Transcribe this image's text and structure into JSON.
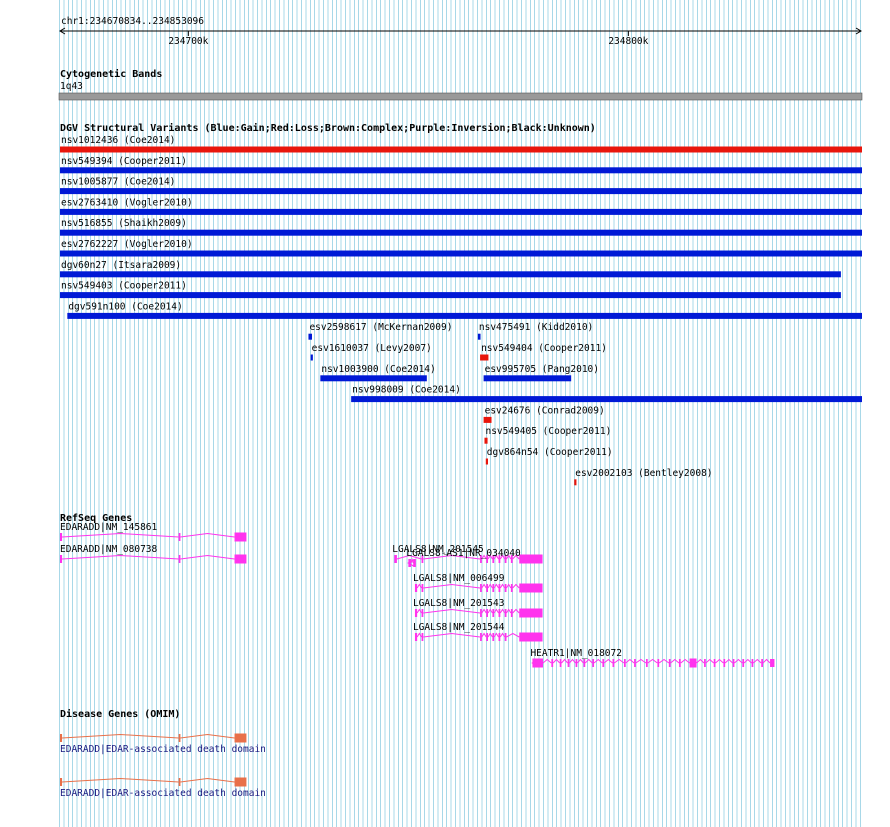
{
  "ruler": {
    "position_label": "chr1:234670834..234853096",
    "ticks": [
      {
        "pos": 234700000,
        "label": "234700k"
      },
      {
        "pos": 234800000,
        "label": "234800k"
      }
    ],
    "start": 234670834,
    "end": 234853096
  },
  "tracks": {
    "cytoband": {
      "title": "Cytogenetic Bands",
      "band_label": "1q43",
      "color": "#999999"
    },
    "dgv": {
      "title": "DGV Structural Variants (Blue:Gain;Red:Loss;Brown:Complex;Purple:Inversion;Black:Unknown)",
      "colors": {
        "gain": "#0019d6",
        "loss": "#e8160c"
      },
      "features": [
        {
          "label": "nsv1012436 (Coe2014)",
          "type": "loss",
          "start": 234670834,
          "end": 234853096
        },
        {
          "label": "nsv549394 (Cooper2011)",
          "type": "gain",
          "start": 234670834,
          "end": 234853096
        },
        {
          "label": "nsv1005877 (Coe2014)",
          "type": "gain",
          "start": 234670834,
          "end": 234853096
        },
        {
          "label": "esv2763410 (Vogler2010)",
          "type": "gain",
          "start": 234670834,
          "end": 234853096
        },
        {
          "label": "nsv516855 (Shaikh2009)",
          "type": "gain",
          "start": 234670834,
          "end": 234853096
        },
        {
          "label": "esv2762227 (Vogler2010)",
          "type": "gain",
          "start": 234670834,
          "end": 234853096
        },
        {
          "label": "dgv60n27 (Itsara2009)",
          "type": "gain",
          "start": 234670834,
          "end": 234848300
        },
        {
          "label": "nsv549403 (Cooper2011)",
          "type": "gain",
          "start": 234670834,
          "end": 234848300
        },
        {
          "label": "dgv591n100 (Coe2014)",
          "type": "gain",
          "start": 234672500,
          "end": 234853096
        },
        {
          "label": "esv2598617 (McKernan2009)",
          "type": "gain",
          "start": 234727300,
          "end": 234728100
        },
        {
          "label": "nsv475491 (Kidd2010)",
          "type": "gain",
          "start": 234765800,
          "end": 234766400
        },
        {
          "label": "esv1610037 (Levy2007)",
          "type": "gain",
          "start": 234727800,
          "end": 234728300
        },
        {
          "label": "nsv549404 (Cooper2011)",
          "type": "loss",
          "start": 234766300,
          "end": 234768200
        },
        {
          "label": "nsv1003900 (Coe2014)",
          "type": "gain",
          "start": 234730000,
          "end": 234754200
        },
        {
          "label": "esv995705 (Pang2010)",
          "type": "gain",
          "start": 234767100,
          "end": 234787000
        },
        {
          "label": "nsv998009 (Coe2014)",
          "type": "gain",
          "start": 234737000,
          "end": 234853096
        },
        {
          "label": "esv24676 (Conrad2009)",
          "type": "loss",
          "start": 234767100,
          "end": 234768900
        },
        {
          "label": "nsv549405 (Cooper2011)",
          "type": "loss",
          "start": 234767300,
          "end": 234768000
        },
        {
          "label": "dgv864n54 (Cooper2011)",
          "type": "loss",
          "start": 234767600,
          "end": 234768100
        },
        {
          "label": "esv2002103 (Bentley2008)",
          "type": "loss",
          "start": 234787700,
          "end": 234788200
        }
      ]
    },
    "refseq": {
      "title": "RefSeq Genes",
      "color": "#ff33ee",
      "genes": [
        {
          "label": "EDARADD|NM_145861",
          "strand": "+",
          "start": 234670834,
          "end": 234713200,
          "exons": [
            [
              234670834,
              234671300
            ],
            [
              234697800,
              234698200
            ],
            [
              234710500,
              234713200
            ]
          ]
        },
        {
          "label": "EDARADD|NM_080738",
          "strand": "+",
          "start": 234670834,
          "end": 234713200,
          "exons": [
            [
              234670834,
              234671300
            ],
            [
              234697800,
              234698200
            ],
            [
              234710500,
              234713200
            ]
          ]
        },
        {
          "label": "LGALS8|NM_201545",
          "strand": "+",
          "start": 234746800,
          "end": 234780500,
          "exons": [
            [
              234746800,
              234747400
            ],
            [
              234753000,
              234753400
            ],
            [
              234766300,
              234766700
            ],
            [
              234767700,
              234768100
            ],
            [
              234769100,
              234769500
            ],
            [
              234770500,
              234770900
            ],
            [
              234771900,
              234772300
            ],
            [
              234773300,
              234773700
            ],
            [
              234775200,
              234780500
            ]
          ]
        },
        {
          "label": "LGALS8-AS1|NR_034040",
          "strand": "-",
          "start": 234750000,
          "end": 234751700,
          "exons": [
            [
              234750000,
              234750600
            ],
            [
              234751100,
              234751700
            ]
          ]
        },
        {
          "label": "LGALS8|NM_006499",
          "strand": "+",
          "start": 234751500,
          "end": 234780500,
          "exons": [
            [
              234751500,
              234752000
            ],
            [
              234753000,
              234753400
            ],
            [
              234766300,
              234766700
            ],
            [
              234767700,
              234768100
            ],
            [
              234769100,
              234769500
            ],
            [
              234770500,
              234770900
            ],
            [
              234771900,
              234772300
            ],
            [
              234773300,
              234773700
            ],
            [
              234775200,
              234780500
            ]
          ]
        },
        {
          "label": "LGALS8|NM_201543",
          "strand": "+",
          "start": 234751500,
          "end": 234780500,
          "exons": [
            [
              234751500,
              234752000
            ],
            [
              234753000,
              234753400
            ],
            [
              234766300,
              234766700
            ],
            [
              234767700,
              234768100
            ],
            [
              234769100,
              234769500
            ],
            [
              234770500,
              234770900
            ],
            [
              234771900,
              234772300
            ],
            [
              234773300,
              234773700
            ],
            [
              234775200,
              234780500
            ]
          ]
        },
        {
          "label": "LGALS8|NM_201544",
          "strand": "+",
          "start": 234751500,
          "end": 234780500,
          "exons": [
            [
              234751500,
              234752000
            ],
            [
              234753000,
              234753400
            ],
            [
              234766300,
              234766700
            ],
            [
              234767700,
              234768100
            ],
            [
              234769100,
              234769500
            ],
            [
              234770500,
              234770900
            ],
            [
              234771900,
              234772300
            ],
            [
              234775200,
              234780500
            ]
          ]
        },
        {
          "label": "HEATR1|NM_018072",
          "strand": "-",
          "start": 234778200,
          "end": 234833200,
          "exons": [
            [
              234778200,
              234780600
            ],
            [
              234782500,
              234782900
            ],
            [
              234784400,
              234784800
            ],
            [
              234786200,
              234786600
            ],
            [
              234788000,
              234788400
            ],
            [
              234789800,
              234790200
            ],
            [
              234791800,
              234792200
            ],
            [
              234794100,
              234794500
            ],
            [
              234796400,
              234796800
            ],
            [
              234799000,
              234799400
            ],
            [
              234801300,
              234801700
            ],
            [
              234804000,
              234804400
            ],
            [
              234806600,
              234807000
            ],
            [
              234809200,
              234809600
            ],
            [
              234811500,
              234811900
            ],
            [
              234813900,
              234815500
            ],
            [
              234817200,
              234817600
            ],
            [
              234819400,
              234819800
            ],
            [
              234821600,
              234822000
            ],
            [
              234823700,
              234824100
            ],
            [
              234825900,
              234826300
            ],
            [
              234828000,
              234828400
            ],
            [
              234830200,
              234830600
            ],
            [
              234832200,
              234833200
            ]
          ]
        }
      ]
    },
    "omim": {
      "title": "Disease Genes (OMIM)",
      "color": "#e8704a",
      "genes": [
        {
          "label": "EDARADD|EDAR-associated death domain",
          "start": 234670834,
          "end": 234713200,
          "exons": [
            [
              234670834,
              234671300
            ],
            [
              234697800,
              234698200
            ],
            [
              234710500,
              234713200
            ]
          ]
        },
        {
          "label": "EDARADD|EDAR-associated death domain",
          "start": 234670834,
          "end": 234713200,
          "exons": [
            [
              234670834,
              234671300
            ],
            [
              234697800,
              234698200
            ],
            [
              234710500,
              234713200
            ]
          ]
        }
      ]
    }
  }
}
